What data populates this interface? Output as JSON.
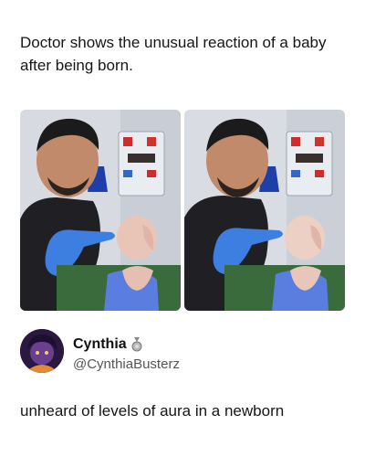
{
  "post": {
    "caption": "Doctor shows the unusual reaction of a baby after being born.",
    "photos": [
      {
        "description_icon": "photo-doctor-newborn-1"
      },
      {
        "description_icon": "photo-doctor-newborn-2"
      }
    ]
  },
  "author": {
    "display_name": "Cynthia",
    "handle": "@CynthiaBusterz",
    "avatar_icon": "avatar-icon",
    "badge_icon": "medal-badge-icon"
  },
  "reply": {
    "text": "unheard of levels of aura in a newborn"
  },
  "colors": {
    "glove": "#3d7fe0",
    "scrubs": "#1f1f24",
    "wall": "#d9dde3",
    "machine_red": "#d22b2b",
    "bed_green": "#3a6b3c"
  }
}
